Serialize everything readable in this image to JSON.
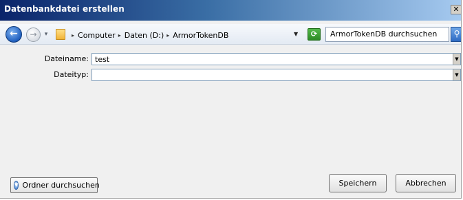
{
  "window": {
    "title": "Datenbankdatei erstellen",
    "close_glyph": "✕"
  },
  "navbar": {
    "back_glyph": "←",
    "forward_glyph": "→",
    "breadcrumb": [
      "Computer",
      "Daten (D:)",
      "ArmorTokenDB"
    ],
    "search_placeholder": "ArmorTokenDB durchsuchen",
    "icons": {
      "back": "back-arrow-icon",
      "forward": "forward-arrow-icon",
      "folder": "folder-icon",
      "refresh": "refresh-icon",
      "search": "search-icon"
    }
  },
  "form": {
    "filename_label": "Dateiname:",
    "filename_value": "test",
    "filetype_label": "Dateityp:",
    "filetype_value": ""
  },
  "footer": {
    "browse_label": "Ordner durchsuchen",
    "save_label": "Speichern",
    "cancel_label": "Abbrechen"
  },
  "colors": {
    "title_gradient_start": "#0a246a",
    "title_gradient_end": "#a6caf0",
    "dialog_bg": "#f0f0f0"
  }
}
